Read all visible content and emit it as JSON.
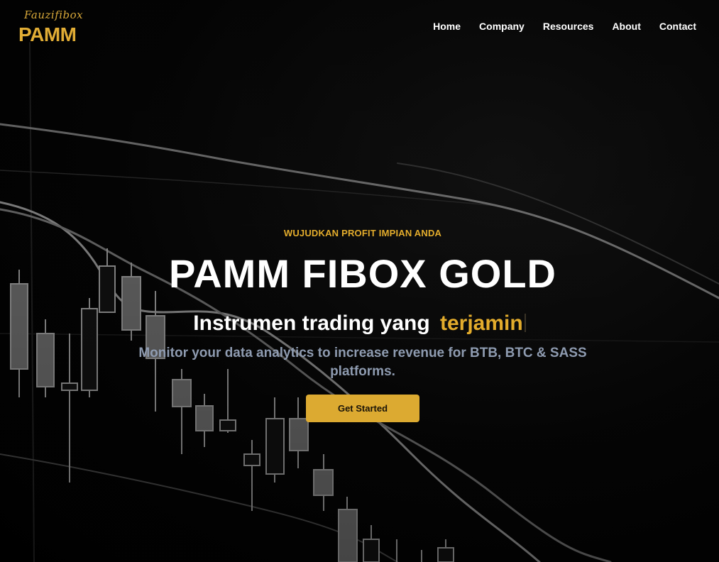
{
  "logo": {
    "script_text": "Fauzifibox",
    "main_text": "PAMM"
  },
  "nav": {
    "items": [
      "Home",
      "Company",
      "Resources",
      "About",
      "Contact"
    ]
  },
  "hero": {
    "eyebrow": "WUJUDKAN PROFIT IMPIAN ANDA",
    "title": "PAMM FIBOX GOLD",
    "subtitle_prefix": "Instrumen trading yang",
    "subtitle_accent": "terjamin",
    "description": "Monitor your data analytics to increase revenue for BTB, BTC & SASS platforms.",
    "cta_label": "Get Started"
  },
  "colors": {
    "accent": "#e3ac2c",
    "background": "#000000",
    "text_primary": "#ffffff",
    "text_muted": "#8e9bb0",
    "button_bg": "#dcaa31"
  }
}
